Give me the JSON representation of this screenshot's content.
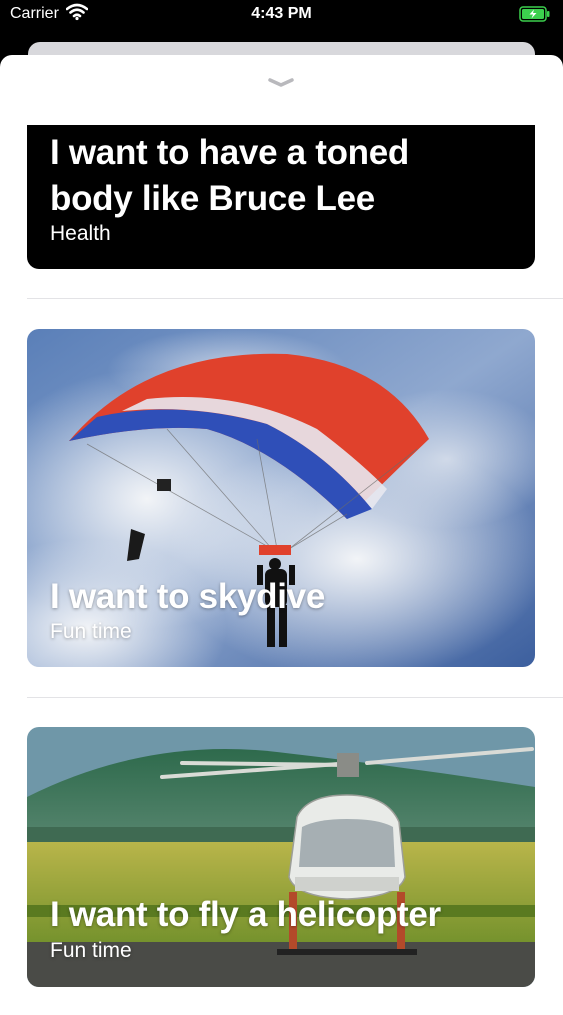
{
  "status_bar": {
    "carrier": "Carrier",
    "time": "4:43 PM"
  },
  "cards": [
    {
      "title_line1": "I want to have a toned",
      "title_line2": "body like Bruce Lee",
      "subtitle": "Health"
    },
    {
      "title": "I want to skydive",
      "subtitle": "Fun time"
    },
    {
      "title": "I want to fly a helicopter",
      "subtitle": "Fun time"
    }
  ],
  "colors": {
    "accent_battery": "#3ccf4e",
    "sheet_bg": "#ffffff",
    "card1_bg": "#000000"
  },
  "icons": [
    "wifi-icon",
    "battery-charging-icon",
    "chevron-down-icon"
  ]
}
